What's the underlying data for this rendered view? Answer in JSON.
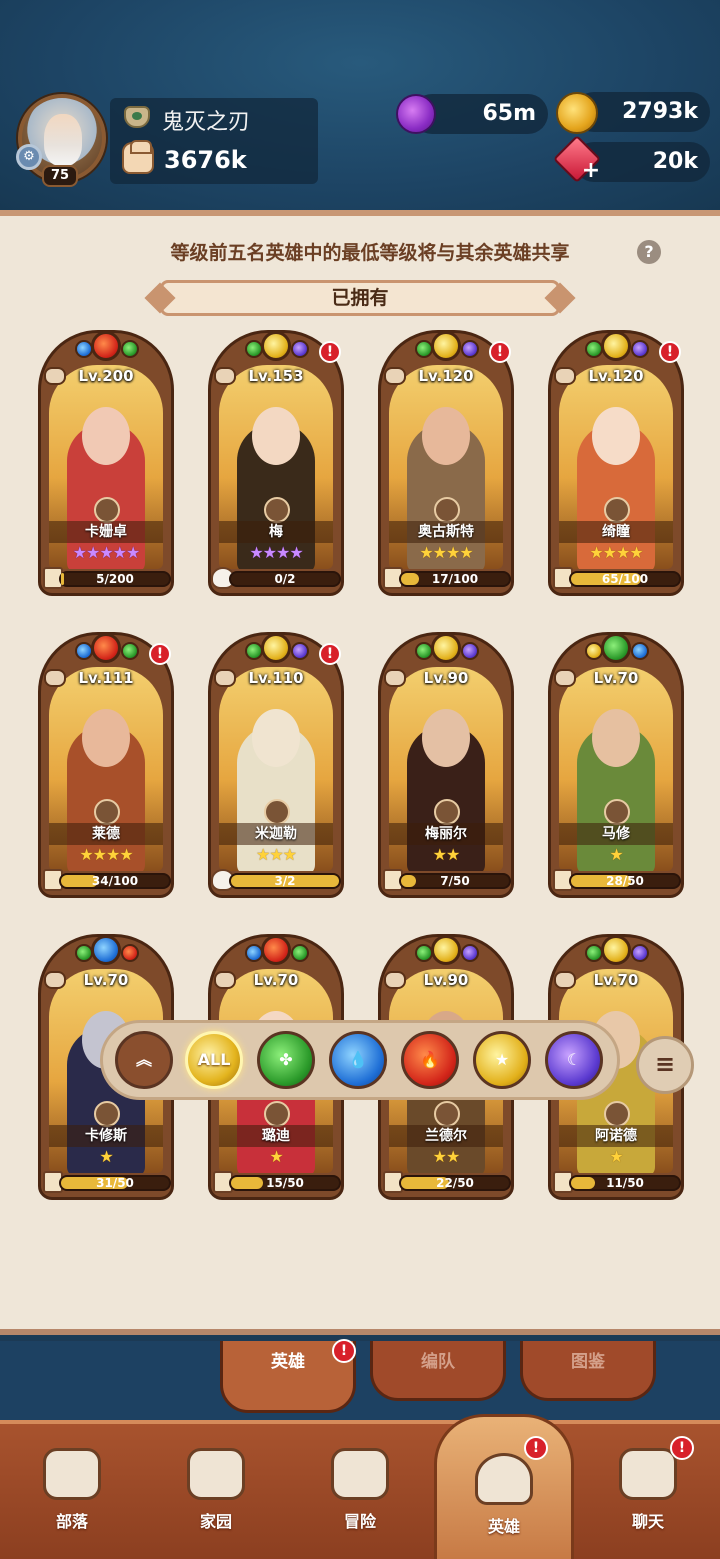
{
  "player": {
    "level": "75",
    "name": "鬼灭之刃",
    "power": "3676k"
  },
  "resources": {
    "potion": "65m",
    "gold": "2793k",
    "gems": "20k"
  },
  "panel": {
    "share_notice": "等级前五名英雄中的最低等级将与其余英雄共享",
    "help": "?",
    "owned_title": "已拥有"
  },
  "heroes": [
    {
      "level": "Lv.200",
      "name": "卡姗卓",
      "stars": "★★★★★",
      "star_color": "purple",
      "progress": "5/200",
      "progress_ratio": 0.025,
      "alert": false,
      "element": "fire"
    },
    {
      "level": "Lv.153",
      "name": "梅",
      "stars": "★★★★",
      "star_color": "purple",
      "progress": "0/2",
      "progress_ratio": 0,
      "alert": true,
      "element": "light"
    },
    {
      "level": "Lv.120",
      "name": "奥古斯特",
      "stars": "★★★★",
      "star_color": "gold",
      "progress": "17/100",
      "progress_ratio": 0.17,
      "alert": true,
      "element": "light"
    },
    {
      "level": "Lv.120",
      "name": "绮瞳",
      "stars": "★★★★",
      "star_color": "gold",
      "progress": "65/100",
      "progress_ratio": 0.65,
      "alert": true,
      "element": "light"
    },
    {
      "level": "Lv.111",
      "name": "莱德",
      "stars": "★★★★",
      "star_color": "gold",
      "progress": "34/100",
      "progress_ratio": 0.34,
      "alert": true,
      "element": "fire"
    },
    {
      "level": "Lv.110",
      "name": "米迦勒",
      "stars": "★★★",
      "star_color": "gold",
      "progress": "3/2",
      "progress_ratio": 1,
      "alert": true,
      "element": "light"
    },
    {
      "level": "Lv.90",
      "name": "梅丽尔",
      "stars": "★★",
      "star_color": "gold",
      "progress": "7/50",
      "progress_ratio": 0.14,
      "alert": false,
      "element": "light"
    },
    {
      "level": "Lv.70",
      "name": "马修",
      "stars": "★",
      "star_color": "gold",
      "progress": "28/50",
      "progress_ratio": 0.56,
      "alert": false,
      "element": "nature"
    },
    {
      "level": "Lv.70",
      "name": "卡修斯",
      "stars": "★",
      "star_color": "gold",
      "progress": "31/50",
      "progress_ratio": 0.62,
      "alert": false,
      "element": "water"
    },
    {
      "level": "Lv.70",
      "name": "璐迪",
      "stars": "★",
      "star_color": "gold",
      "progress": "15/50",
      "progress_ratio": 0.3,
      "alert": false,
      "element": "fire"
    },
    {
      "level": "Lv.90",
      "name": "兰德尔",
      "stars": "★★",
      "star_color": "gold",
      "progress": "22/50",
      "progress_ratio": 0.44,
      "alert": false,
      "element": "light"
    },
    {
      "level": "Lv.70",
      "name": "阿诺德",
      "stars": "★",
      "star_color": "gold",
      "progress": "11/50",
      "progress_ratio": 0.22,
      "alert": false,
      "element": "light"
    }
  ],
  "filters": {
    "all_label": "ALL",
    "sort": "≡"
  },
  "subtabs": {
    "heroes": "英雄",
    "team": "编队",
    "codex": "图鉴"
  },
  "nav": {
    "tribe": "部落",
    "home": "家园",
    "adventure": "冒险",
    "heroes": "英雄",
    "chat": "聊天"
  },
  "alert_mark": "!"
}
